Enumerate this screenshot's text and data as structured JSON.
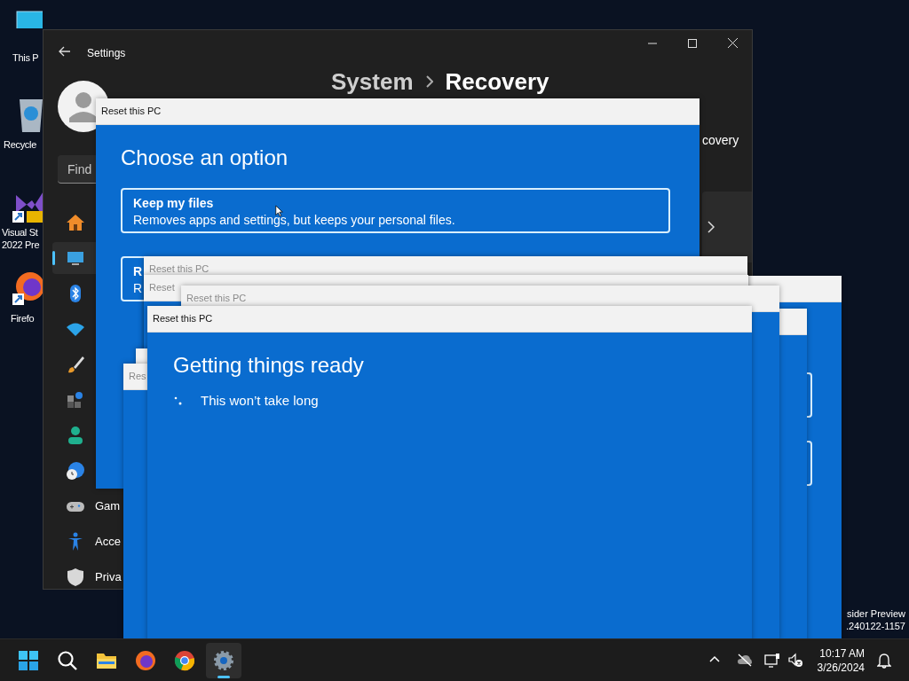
{
  "desktop": {
    "icons": [
      {
        "kind": "pc",
        "lines": [
          "This P"
        ]
      },
      {
        "kind": "recycle",
        "lines": [
          "Recycle"
        ]
      },
      {
        "kind": "vs",
        "lines": [
          "Visual St",
          "2022 Pre"
        ]
      },
      {
        "kind": "firefox",
        "lines": [
          "Firefo"
        ]
      }
    ],
    "build_info": [
      "sider Preview",
      ".240122-1157"
    ]
  },
  "settings": {
    "title": "Settings",
    "breadcrumb": [
      "System",
      "Recovery"
    ],
    "side_text": "covery",
    "search_placeholder": "Find",
    "nav": [
      {
        "kind": "home",
        "selected": false
      },
      {
        "kind": "system",
        "selected": true
      },
      {
        "kind": "bluetooth",
        "selected": false
      },
      {
        "kind": "wifi",
        "selected": false
      },
      {
        "kind": "brush",
        "selected": false
      },
      {
        "kind": "apps",
        "selected": false
      },
      {
        "kind": "person",
        "selected": false
      },
      {
        "kind": "time",
        "selected": false
      },
      {
        "kind": "gaming",
        "label": "Gam",
        "selected": false
      },
      {
        "kind": "accessibility",
        "label": "Acce",
        "selected": false
      },
      {
        "kind": "privacy",
        "label": "Priva",
        "selected": false
      }
    ]
  },
  "dialogs": [
    {
      "kind": "options",
      "title": "Reset this PC",
      "active": true,
      "heading": "Choose an option",
      "options": [
        {
          "title": "Keep my files",
          "description": "Removes apps and settings, but keeps your personal files."
        },
        {
          "title": "R",
          "description": "R"
        }
      ]
    },
    {
      "kind": "blank_options"
    },
    {
      "kind": "blank"
    },
    {
      "kind": "blank",
      "title": "Reset this PC",
      "active": false
    },
    {
      "kind": "blank",
      "title": "Reset",
      "active": false
    },
    {
      "kind": "blank",
      "title": "Reset this PC",
      "active": false
    },
    {
      "kind": "blank"
    },
    {
      "kind": "blank",
      "title": "Res",
      "active": false
    },
    {
      "kind": "progress",
      "title": "Reset this PC",
      "active": true,
      "heading": "Getting things ready",
      "message": "This won’t take long"
    }
  ],
  "taskbar": {
    "apps": [
      {
        "kind": "start",
        "selected": false
      },
      {
        "kind": "search",
        "selected": false
      },
      {
        "kind": "explorer",
        "selected": false
      },
      {
        "kind": "firefox",
        "selected": false
      },
      {
        "kind": "chrome",
        "selected": false
      },
      {
        "kind": "settings",
        "selected": true
      }
    ],
    "tray": [
      {
        "kind": "chevron"
      },
      {
        "kind": "cloud"
      },
      {
        "kind": "network"
      },
      {
        "kind": "volume"
      }
    ],
    "time": "10:17 AM",
    "date": "3/26/2024"
  }
}
